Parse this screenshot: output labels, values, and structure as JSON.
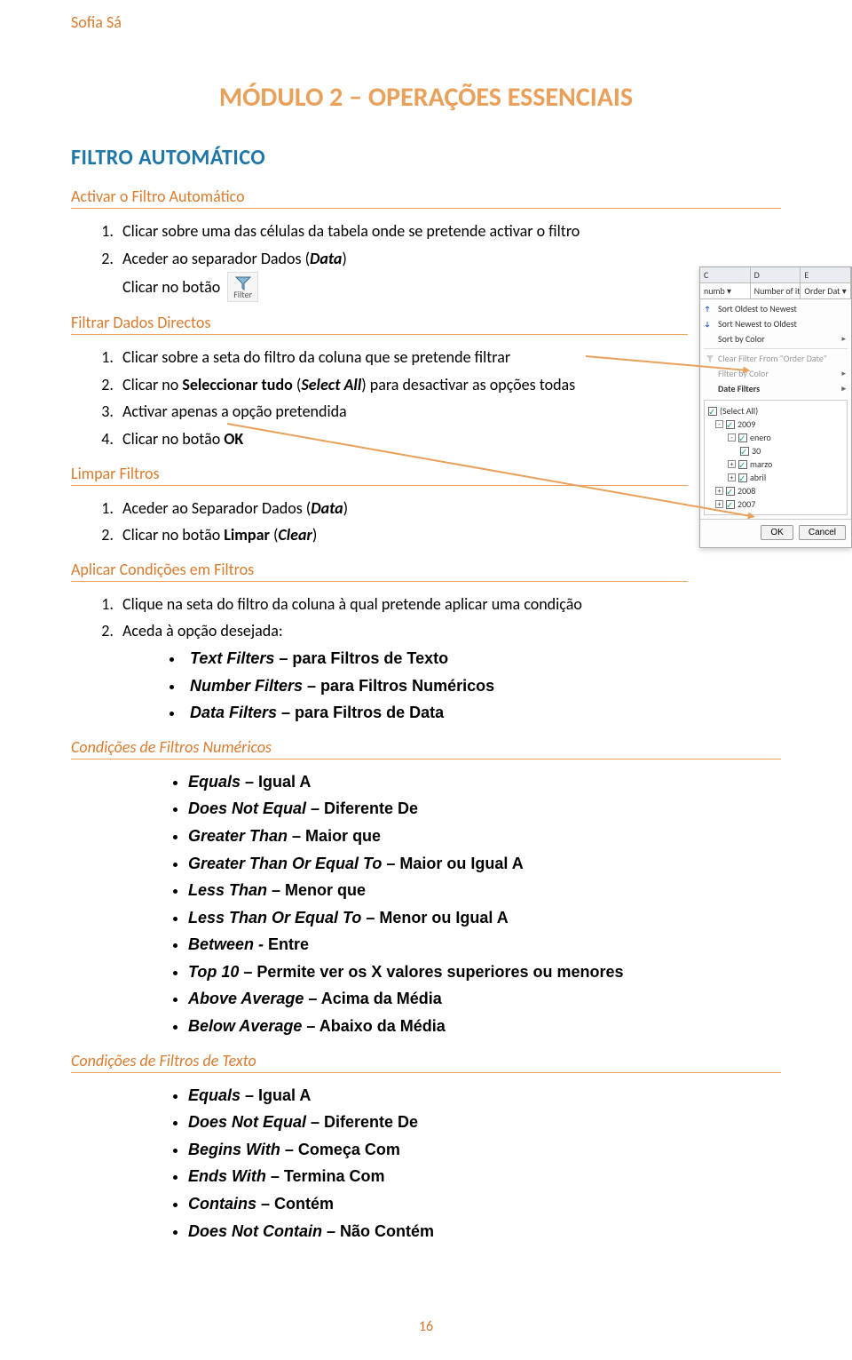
{
  "author": "Sofia Sá",
  "module_title": "MÓDULO 2 – OPERAÇÕES ESSENCIAIS",
  "h1": "FILTRO AUTOMÁTICO",
  "sections": {
    "activar": {
      "title": "Activar o Filtro Automático",
      "steps_1": "Clicar sobre uma das células da tabela onde se pretende activar o filtro",
      "steps_2_pre": "Aceder ao separador Dados (",
      "steps_2_em": "Data",
      "steps_2_post": ")",
      "steps_3": "Clicar no botão",
      "filter_label": "Filter"
    },
    "directos": {
      "title": "Filtrar Dados Directos",
      "steps_1": "Clicar sobre a seta do filtro da coluna que se pretende filtrar",
      "steps_2_pre": "Clicar no ",
      "steps_2_b": "Seleccionar tudo",
      "steps_2_mid": " (",
      "steps_2_em": "Select All",
      "steps_2_post": ") para desactivar as opções todas",
      "steps_3": "Activar apenas a opção pretendida",
      "steps_4_pre": "Clicar no botão ",
      "steps_4_b": "OK"
    },
    "limpar": {
      "title": "Limpar Filtros",
      "steps_1_pre": "Aceder ao Separador Dados (",
      "steps_1_em": "Data",
      "steps_1_post": ")",
      "steps_2_pre": "Clicar no botão ",
      "steps_2_b": "Limpar",
      "steps_2_mid": " (",
      "steps_2_em": "Clear",
      "steps_2_post": ")"
    },
    "aplicar": {
      "title": "Aplicar Condições em Filtros",
      "steps_1": "Clique na seta do filtro da coluna à qual pretende aplicar uma condição",
      "steps_2": "Aceda à opção desejada:",
      "opts": [
        {
          "b": "Text Filters",
          "t": " – para Filtros de Texto"
        },
        {
          "b": "Number Filters",
          "t": " – para Filtros Numéricos"
        },
        {
          "b": "Data Filters",
          "t": " – para Filtros de Data"
        }
      ]
    },
    "num": {
      "title": "Condições de Filtros Numéricos",
      "items": [
        {
          "b": "Equals",
          "t": " – Igual A"
        },
        {
          "b": "Does Not Equal",
          "t": " – Diferente De"
        },
        {
          "b": "Greater Than",
          "t": " – Maior que"
        },
        {
          "b": "Greater Than Or Equal To",
          "t": " – Maior ou Igual A"
        },
        {
          "b": "Less Than",
          "t": " – Menor que"
        },
        {
          "b": "Less Than Or Equal To",
          "t": " – Menor ou Igual A"
        },
        {
          "b": "Between -",
          "t": " Entre"
        },
        {
          "b": "Top 10",
          "t": " – Permite ver os X valores superiores ou menores"
        },
        {
          "b": "Above Average",
          "t": " – Acima da Média"
        },
        {
          "b": "Below Average",
          "t": " – Abaixo da Média"
        }
      ]
    },
    "txt": {
      "title": "Condições de Filtros de Texto",
      "items": [
        {
          "b": "Equals",
          "t": " – Igual A"
        },
        {
          "b": "Does Not Equal",
          "t": " – Diferente De"
        },
        {
          "b": "Begins With",
          "t": " – Começa Com"
        },
        {
          "b": "Ends With",
          "t": " – Termina Com"
        },
        {
          "b": "Contains",
          "t": " – Contém"
        },
        {
          "b": "Does Not Contain",
          "t": " – Não Contém"
        }
      ]
    }
  },
  "popup": {
    "cols": [
      "C",
      "D",
      "E"
    ],
    "headers": [
      "numb ▾",
      "Number of ite ▾",
      "Order Dat ▾"
    ],
    "sort_oldest": "Sort Oldest to Newest",
    "sort_newest": "Sort Newest to Oldest",
    "sort_color": "Sort by Color",
    "clear_filter": "Clear Filter From \"Order Date\"",
    "filter_color": "Filter by Color",
    "date_filters": "Date Filters",
    "select_all": "(Select All)",
    "tree": {
      "y2009": "2009",
      "enero": "enero",
      "d30": "30",
      "marzo": "marzo",
      "abril": "abril",
      "y2008": "2008",
      "y2007": "2007"
    },
    "ok": "OK",
    "cancel": "Cancel"
  },
  "page_number": "16"
}
